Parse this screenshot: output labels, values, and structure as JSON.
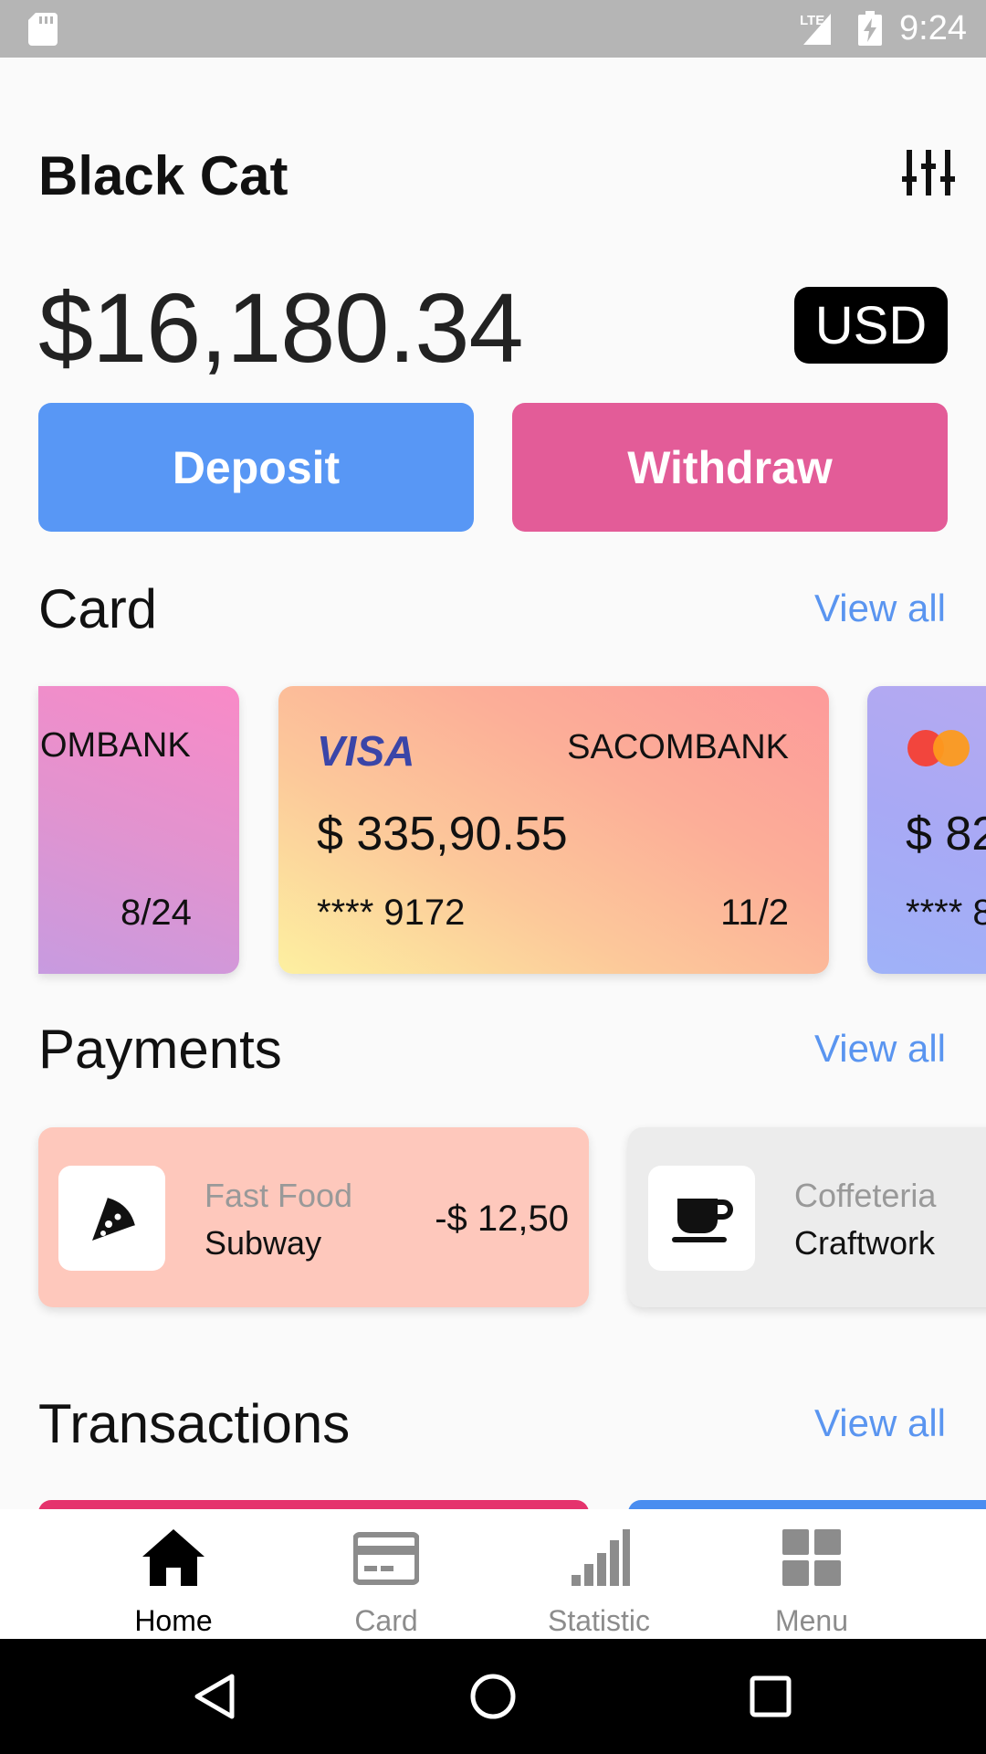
{
  "status_bar": {
    "network": "LTE",
    "time": "9:24",
    "icons": [
      "sd-card-icon",
      "signal-icon",
      "battery-charging-icon"
    ]
  },
  "header": {
    "title": "Black Cat",
    "settings_icon": "sliders-icon"
  },
  "balance": {
    "amount": "$16,180.34",
    "currency": "USD"
  },
  "actions": {
    "deposit_label": "Deposit",
    "withdraw_label": "Withdraw",
    "deposit_color": "#5897f5",
    "withdraw_color": "#e35c98"
  },
  "card_section": {
    "title": "Card",
    "view_all": "View all",
    "cards": [
      {
        "bank": "OMBANK",
        "expiry": "8/24"
      },
      {
        "brand": "VISA",
        "bank": "SACOMBANK",
        "amount": "$ 335,90.55",
        "number": "**** 9172",
        "expiry": "11/2"
      },
      {
        "brand_icon": "mastercard-icon",
        "amount": "$ 82",
        "number": "**** 8"
      }
    ]
  },
  "payments_section": {
    "title": "Payments",
    "view_all": "View all",
    "items": [
      {
        "icon": "pizza-icon",
        "category": "Fast Food",
        "name": "Subway",
        "amount": "-$ 12,50"
      },
      {
        "icon": "coffee-cup-icon",
        "category": "Coffeteria",
        "name": "Craftwork"
      }
    ]
  },
  "transactions_section": {
    "title": "Transactions",
    "view_all": "View all"
  },
  "bottom_nav": {
    "items": [
      {
        "label": "Home",
        "icon": "home-icon",
        "active": true
      },
      {
        "label": "Card",
        "icon": "credit-card-icon",
        "active": false
      },
      {
        "label": "Statistic",
        "icon": "bar-chart-icon",
        "active": false
      },
      {
        "label": "Menu",
        "icon": "grid-icon",
        "active": false
      }
    ]
  },
  "system_nav": {
    "icons": [
      "back-icon",
      "home-circle-icon",
      "recents-icon"
    ]
  }
}
